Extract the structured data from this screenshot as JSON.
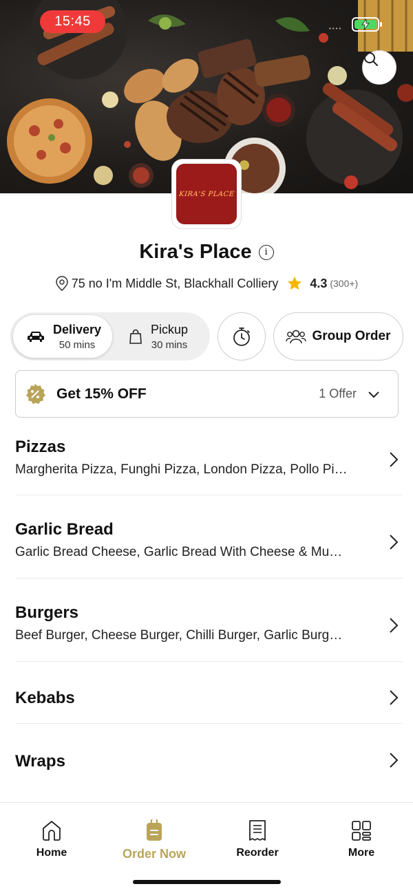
{
  "status": {
    "time": "15:45"
  },
  "restaurant": {
    "name": "Kira's Place",
    "logo_text": "KIRA'S PLACE",
    "address": "75 no I'm Middle St, Blackhall Colliery",
    "rating": "4.3",
    "rating_count": "(300+)"
  },
  "modes": [
    {
      "label": "Delivery",
      "time": "50 mins"
    },
    {
      "label": "Pickup",
      "time": "30 mins"
    }
  ],
  "group_order_label": "Group Order",
  "offer": {
    "title": "Get 15% OFF",
    "count": "1 Offer"
  },
  "categories": [
    {
      "name": "Pizzas",
      "items": "Margherita Pizza, Funghi Pizza, London Pizza, Pollo Pi…"
    },
    {
      "name": "Garlic Bread",
      "items": "Garlic Bread Cheese, Garlic Bread With Cheese & Mu…"
    },
    {
      "name": "Burgers",
      "items": "Beef Burger, Cheese Burger, Chilli Burger, Garlic Burg…"
    },
    {
      "name": "Kebabs"
    },
    {
      "name": "Wraps"
    }
  ],
  "nav": [
    {
      "label": "Home",
      "icon": "home-icon"
    },
    {
      "label": "Order Now",
      "icon": "order-icon"
    },
    {
      "label": "Reorder",
      "icon": "receipt-icon"
    },
    {
      "label": "More",
      "icon": "grid-icon"
    }
  ],
  "colors": {
    "accent": "#b9a45a",
    "status_pill": "#f03a3a",
    "star": "#f5b700",
    "logo_bg": "#9b1b1b"
  }
}
